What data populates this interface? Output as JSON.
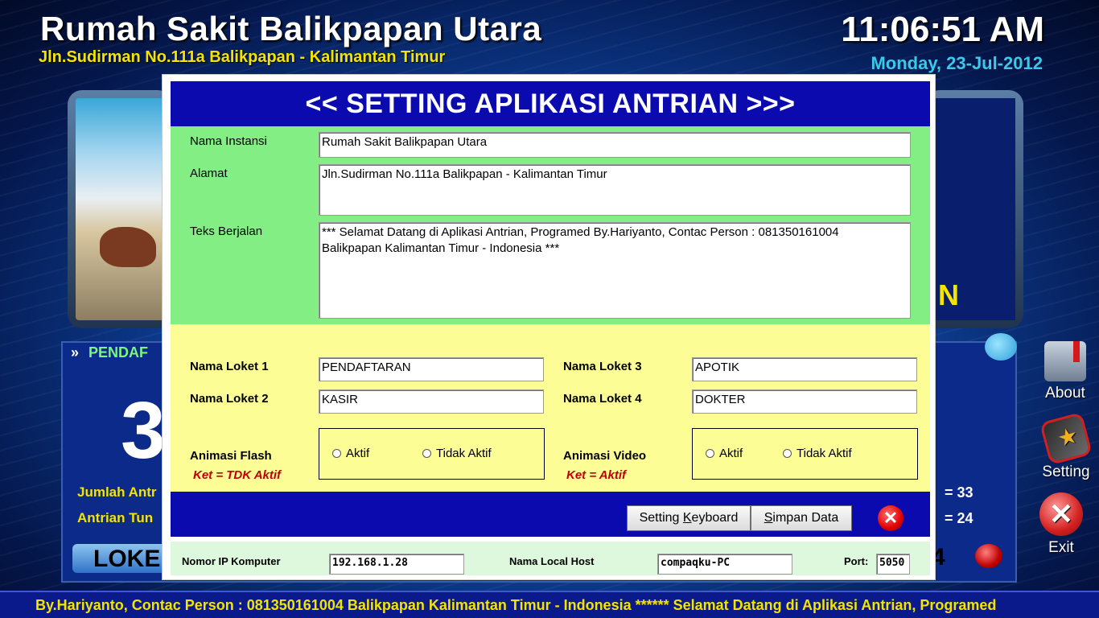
{
  "header": {
    "title": "Rumah Sakit Balikpapan Utara",
    "address": "Jln.Sudirman No.111a Balikpapan - Kalimantan Timur",
    "time": "11:06:51 AM",
    "date": "Monday, 23-Jul-2012"
  },
  "background": {
    "right_letter": "N",
    "pendaf_arrow": "»",
    "pendaf_label": "PENDAF",
    "big_number": "3",
    "jumlah_label": "Jumlah Antr",
    "antrian_label": "Antrian Tun",
    "jumlah_value": "=   33",
    "antrian_value": "=   24",
    "loket_label": "LOKE",
    "loket_right": "4"
  },
  "side_menu": {
    "about": "About",
    "setting": "Setting",
    "exit": "Exit",
    "exit_glyph": "✕"
  },
  "footer": {
    "marquee": "By.Hariyanto, Contac Person : 081350161004 Balikpapan Kalimantan Timur - Indonesia ****** Selamat Datang di Aplikasi Antrian, Programed"
  },
  "dialog": {
    "title": "<< SETTING APLIKASI ANTRIAN >>>",
    "nama_instansi_label": "Nama Instansi",
    "nama_instansi_value": "Rumah Sakit Balikpapan Utara",
    "alamat_label": "Alamat",
    "alamat_value": "Jln.Sudirman No.111a Balikpapan - Kalimantan Timur",
    "teks_label": "Teks Berjalan",
    "teks_value": "*** Selamat Datang di Aplikasi Antrian, Programed By.Hariyanto, Contac Person : 081350161004\nBalikpapan Kalimantan Timur - Indonesia ***",
    "loket1_label": "Nama Loket 1",
    "loket1_value": "PENDAFTARAN",
    "loket2_label": "Nama Loket 2",
    "loket2_value": "KASIR",
    "loket3_label": "Nama Loket 3",
    "loket3_value": "APOTIK",
    "loket4_label": "Nama Loket 4",
    "loket4_value": "DOKTER",
    "anim_flash_label": "Animasi Flash",
    "anim_flash_ket": "Ket = TDK Aktif",
    "anim_video_label": "Animasi Video",
    "anim_video_ket": "Ket = Aktif",
    "radio_aktif": "Aktif",
    "radio_tidak": "Tidak Aktif",
    "btn_keyboard_pre": "Setting ",
    "btn_keyboard_u": "K",
    "btn_keyboard_post": "eyboard",
    "btn_simpan_u": "S",
    "btn_simpan_post": "impan Data",
    "close_glyph": "✕",
    "ip_label": "Nomor IP Komputer",
    "ip_value": "192.168.1.28",
    "host_label": "Nama Local Host",
    "host_value": "compaqku-PC",
    "port_label": "Port:",
    "port_value": "5050"
  }
}
